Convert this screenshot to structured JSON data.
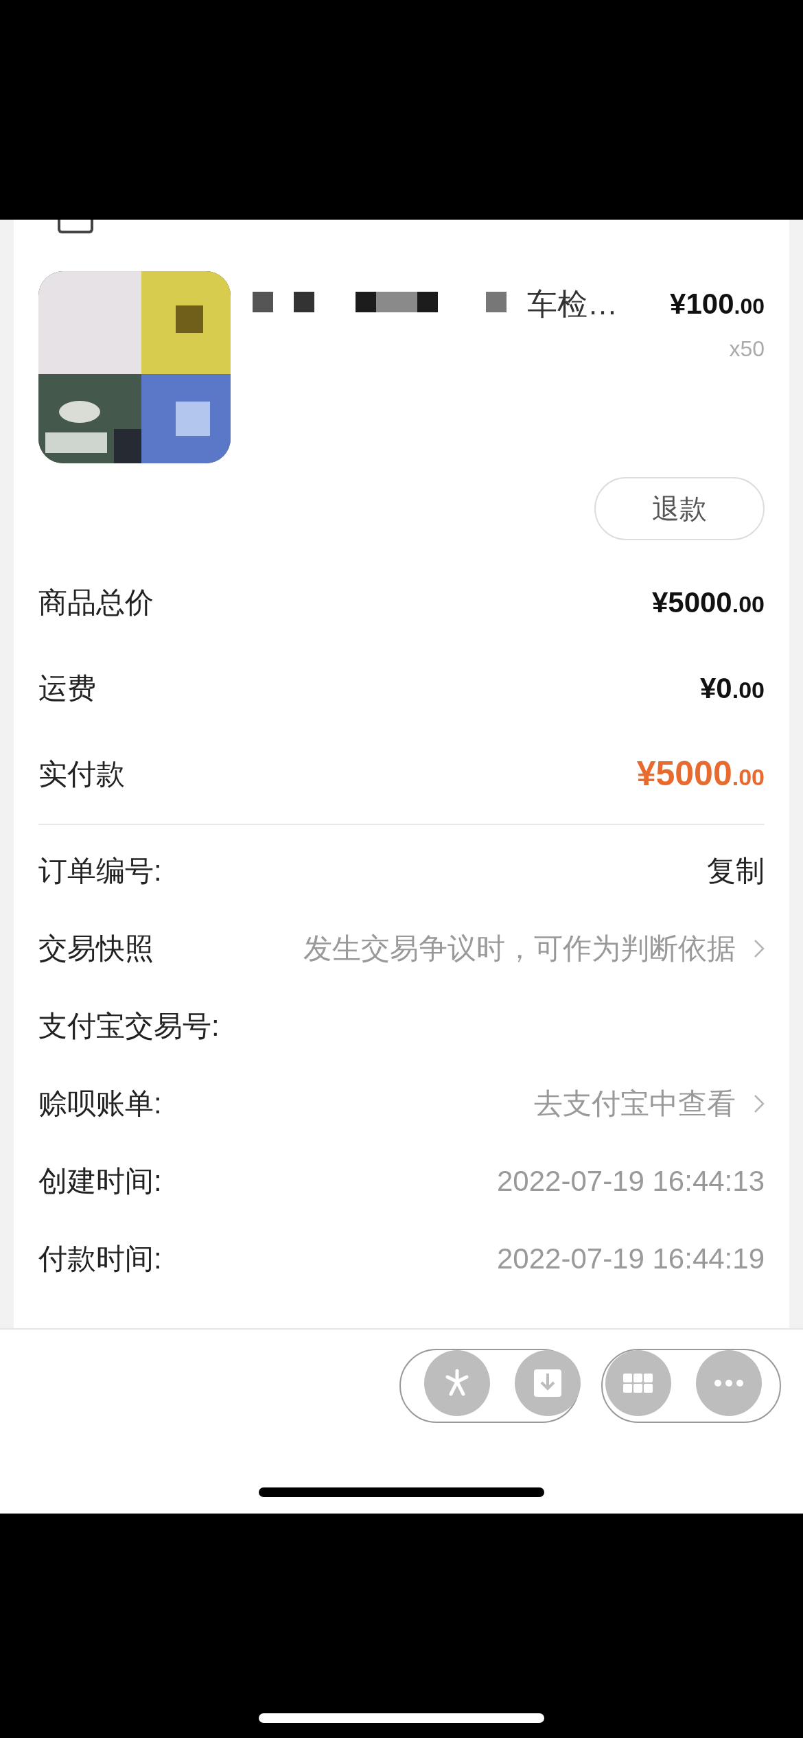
{
  "product": {
    "title": "车检…",
    "price_main": "¥100",
    "price_cents": ".00",
    "quantity": "x50",
    "refund_button": "退款"
  },
  "summary": [
    {
      "label": "商品总价",
      "main": "¥5000",
      "cents": ".00",
      "kind": "normal"
    },
    {
      "label": "运费",
      "main": "¥0",
      "cents": ".00",
      "kind": "normal"
    },
    {
      "label": "实付款",
      "main": "¥5000",
      "cents": ".00",
      "kind": "highlight"
    }
  ],
  "details": [
    {
      "label": "订单编号:",
      "action": "复制",
      "kind": "copy"
    },
    {
      "label": "交易快照",
      "value": "发生交易争议时，可作为判断依据",
      "kind": "link"
    },
    {
      "label": "支付宝交易号:",
      "kind": "text"
    },
    {
      "label": "赊呗账单:",
      "value": "去支付宝中查看",
      "kind": "link"
    },
    {
      "label": "创建时间:",
      "value": "2022-07-19 16:44:13",
      "kind": "text"
    },
    {
      "label": "付款时间:",
      "value": "2022-07-19 16:44:19",
      "kind": "text"
    }
  ]
}
